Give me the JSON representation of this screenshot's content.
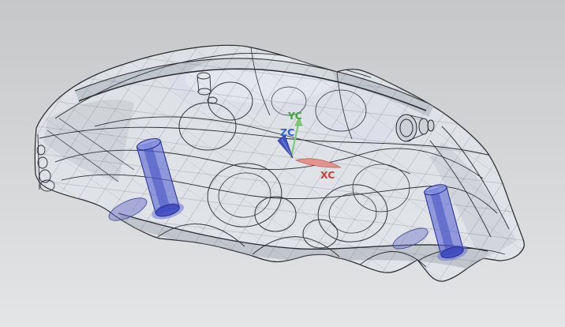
{
  "viewport": {
    "name": "cad-graphics-window",
    "background_top": "#c6c7c9",
    "background_bottom": "#e4e5e7"
  },
  "model": {
    "name": "brake-caliper-wireframe-model",
    "body_fill": "#e1e4e9",
    "body_shade": "#aeb4bc",
    "edge_color": "#26282c",
    "highlight_fill": "#5c68d6",
    "highlight_core": "#3c48be",
    "highlight_cap": "#8a94e2",
    "highlight_edge": "#232e8e"
  },
  "triad": {
    "labels": {
      "x": "XC",
      "y": "YC",
      "z": "ZC"
    },
    "label_colors": {
      "x": "#c2443c",
      "y": "#3aa93a",
      "z": "#2f62d8"
    },
    "arrow_colors": {
      "x": "#e2938b",
      "y": "#7ecb76",
      "z": "#4054c4"
    }
  }
}
